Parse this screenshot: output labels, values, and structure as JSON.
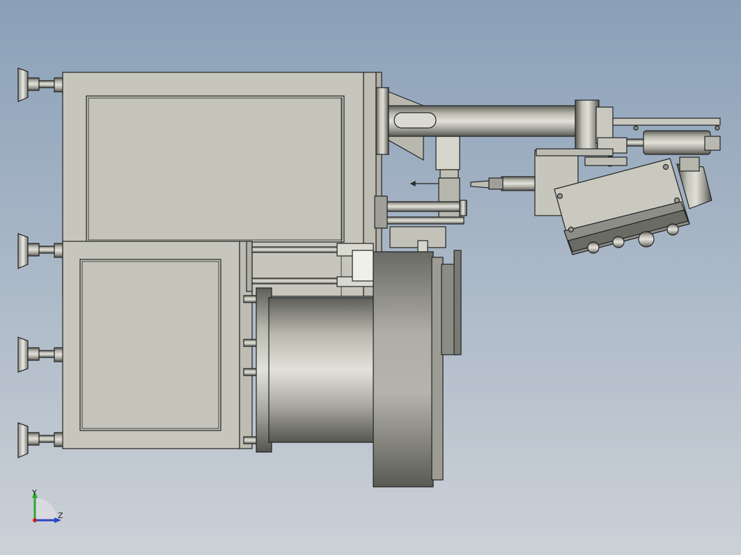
{
  "viewport": {
    "background_top": "#8aa0b8",
    "background_bottom": "#c9cfd6",
    "part_fill": "#c7c7bd",
    "part_edge": "#222222",
    "metal_dark": "#6e6e68",
    "metal_light": "#e6e6de"
  },
  "triad": {
    "y_label": "Y",
    "z_label": "Z",
    "y_color": "#2ea82e",
    "z_color": "#2a44c8",
    "x_color": "#cc2222"
  }
}
